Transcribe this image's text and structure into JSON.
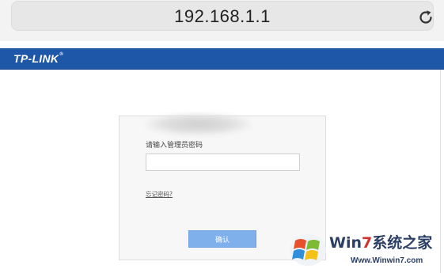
{
  "browser": {
    "url": "192.168.1.1",
    "reload_icon": "reload-icon"
  },
  "header": {
    "brand": "TP-LINK",
    "brand_mark": "®",
    "brand_color": "#1e56a8"
  },
  "login": {
    "password_label": "请输入管理员密码",
    "password_value": "",
    "forgot_link": "忘记密码?",
    "confirm_button": "确认",
    "button_color": "#7fb0ec"
  },
  "watermark": {
    "title_prefix": "Win",
    "title_accent": "7",
    "title_suffix": "系统之家",
    "url": "Www.Winwin7.com",
    "logo_icon": "windows-logo-icon"
  }
}
